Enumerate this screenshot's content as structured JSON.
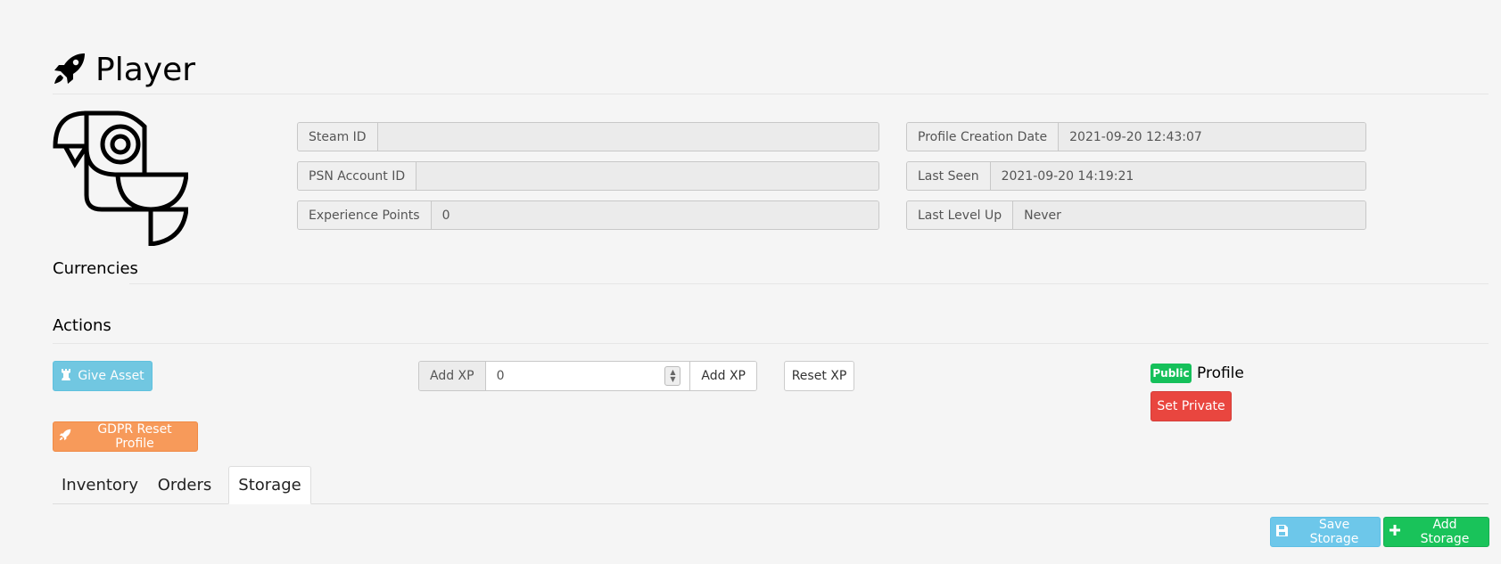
{
  "header": {
    "title": "Player",
    "icon": "rocket-icon"
  },
  "avatar": {
    "icon": "parrot-avatar"
  },
  "profile_fields_left": [
    {
      "label": "Steam ID",
      "value": ""
    },
    {
      "label": "PSN Account ID",
      "value": ""
    },
    {
      "label": "Experience Points",
      "value": "0"
    }
  ],
  "profile_fields_right": [
    {
      "label": "Profile Creation Date",
      "value": "2021-09-20 12:43:07"
    },
    {
      "label": "Last Seen",
      "value": "2021-09-20 14:19:21"
    },
    {
      "label": "Last Level Up",
      "value": "Never"
    }
  ],
  "sections": {
    "currencies": "Currencies",
    "actions": "Actions"
  },
  "actions": {
    "give_asset": "Give Asset",
    "gdpr_reset": "GDPR Reset Profile",
    "xp_addon": "Add XP",
    "xp_value": "0",
    "xp_add_button": "Add XP",
    "reset_xp": "Reset XP",
    "visibility_badge": "Public",
    "visibility_label": "Profile",
    "set_private": "Set Private"
  },
  "tabs": [
    {
      "label": "Inventory",
      "active": false
    },
    {
      "label": "Orders",
      "active": false
    },
    {
      "label": "Storage",
      "active": true
    }
  ],
  "storage_toolbar": {
    "save": "Save Storage",
    "add": "Add Storage"
  },
  "colors": {
    "info": "#5bc0de",
    "warning": "#f79a5a",
    "danger": "#e9463f",
    "success": "#19c35a"
  }
}
